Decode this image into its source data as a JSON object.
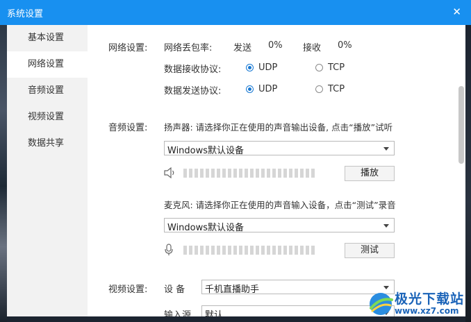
{
  "window": {
    "title": "系统设置"
  },
  "sidebar": {
    "items": [
      {
        "label": "基本设置"
      },
      {
        "label": "网络设置",
        "active": true
      },
      {
        "label": "音频设置"
      },
      {
        "label": "视频设置"
      },
      {
        "label": "数据共享"
      }
    ]
  },
  "network": {
    "section_label": "网络设置:",
    "loss_label": "网络丢包率:",
    "send_label": "发送",
    "send_value": "0%",
    "recv_label": "接收",
    "recv_value": "0%",
    "recv_proto_label": "数据接收协议:",
    "send_proto_label": "数据发送协议:",
    "udp": "UDP",
    "tcp": "TCP"
  },
  "audio": {
    "section_label": "音频设置:",
    "speaker_desc": "扬声器: 请选择你正在使用的声音输出设备, 点击“播放”试听",
    "speaker_device": "Windows默认设备",
    "play_button": "播放",
    "mic_desc": "麦克风: 请选择你正在使用的声音输入设备，点击“测试”录音",
    "mic_device": "Windows默认设备",
    "test_button": "测试"
  },
  "video": {
    "section_label": "视频设置:",
    "device_label": "设 备",
    "device_value": "千机直播助手",
    "input_label": "输入源",
    "input_value": "默认"
  },
  "watermark": {
    "name": "极光下载站",
    "url": "www.xz7.com"
  },
  "colors": {
    "title_bar": "#1890f0",
    "radio_selected": "#1677d2",
    "sidebar_bg": "#f2f2f2"
  }
}
